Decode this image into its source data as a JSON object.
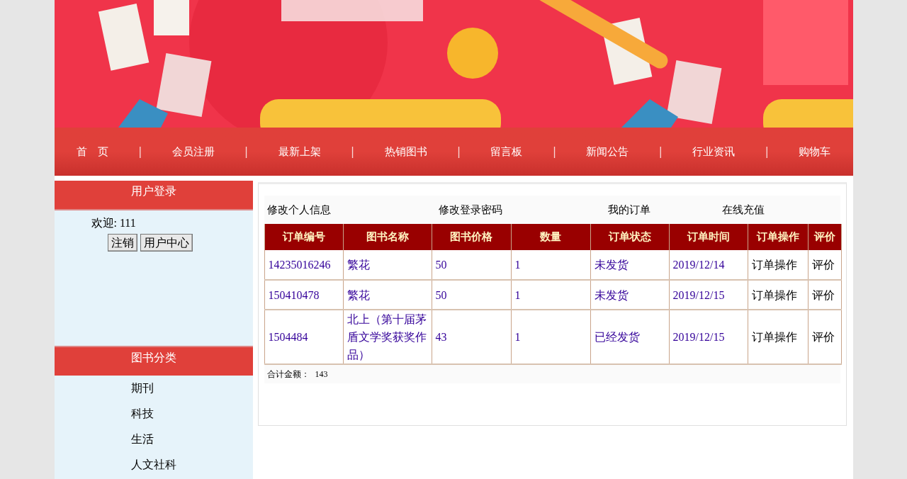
{
  "nav": {
    "separator": "|",
    "items": [
      "首　页",
      "会员注册",
      "最新上架",
      "热销图书",
      "留言板",
      "新闻公告",
      "行业资讯",
      "购物车"
    ]
  },
  "login_panel": {
    "title": "用户登录",
    "welcome": "欢迎: 111",
    "buttons": [
      "注销",
      "用户中心"
    ]
  },
  "category_panel": {
    "title": "图书分类",
    "items": [
      "期刊",
      "科技",
      "生活",
      "人文社科"
    ]
  },
  "user_menu": [
    "修改个人信息",
    "修改登录密码",
    "我的订单",
    "在线充值"
  ],
  "orders": {
    "columns": [
      {
        "label": "订单编号",
        "kind": "link"
      },
      {
        "label": "图书名称",
        "kind": "link"
      },
      {
        "label": "图书价格",
        "kind": "link"
      },
      {
        "label": "数量",
        "kind": "link"
      },
      {
        "label": "订单状态",
        "kind": "link"
      },
      {
        "label": "订单时间",
        "kind": "link"
      },
      {
        "label": "订单操作",
        "kind": "text"
      },
      {
        "label": "评价",
        "kind": "text"
      }
    ],
    "rows": [
      [
        "14235016246",
        "繁花",
        "50",
        "1",
        "未发货",
        "2019/12/14",
        "订单操作",
        "评价"
      ],
      [
        "150410478",
        "繁花",
        "50",
        "1",
        "未发货",
        "2019/12/15",
        "订单操作",
        "评价"
      ],
      [
        "1504484",
        "北上（第十届茅盾文学奖获奖作品）",
        "43",
        "1",
        "已经发货",
        "2019/12/15",
        "订单操作",
        "评价"
      ]
    ],
    "total_label": "合计金额：",
    "total_value": "143"
  }
}
